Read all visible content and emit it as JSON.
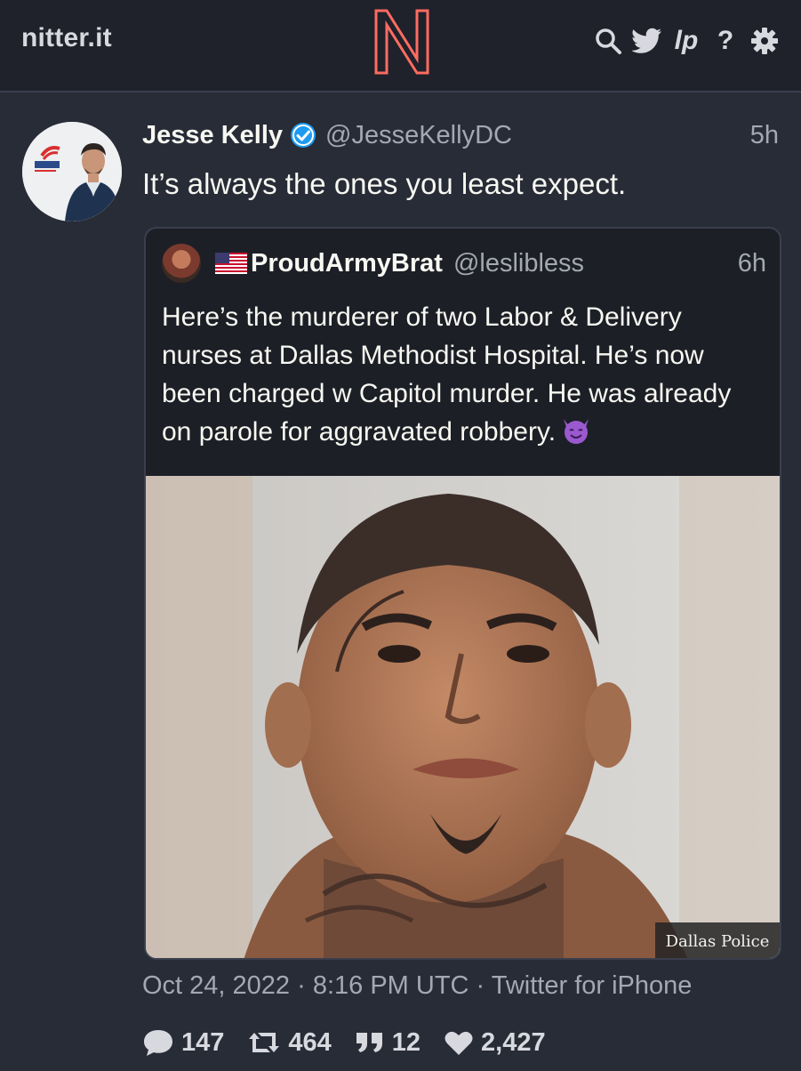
{
  "nav": {
    "site_name": "nitter.it",
    "logo_letter": "N",
    "icons": [
      "search-icon",
      "twitter-bird-icon",
      "lp-icon",
      "help-icon",
      "settings-icon"
    ],
    "lp_text": "lp",
    "help_text": "?"
  },
  "colors": {
    "background": "#282c37",
    "navbar": "#1f212b",
    "accent": "#ff6c60",
    "verified": "#1d9bf0",
    "muted": "#a4a8b2"
  },
  "tweet": {
    "fullname": "Jesse Kelly",
    "username": "@JesseKellyDC",
    "date": "5h",
    "text": "It’s always the ones you least expect.",
    "published": "Oct 24, 2022 · 8:16 PM UTC · Twitter for iPhone",
    "stats": {
      "replies": "147",
      "retweets": "464",
      "quotes": "12",
      "likes": "2,427"
    }
  },
  "quote": {
    "fullname": "ProudArmyBrat",
    "username": "@leslibless",
    "date": "6h",
    "text": "Here’s the murderer of two Labor & Delivery nurses at Dallas Methodist Hospital. He’s now been charged w Capitol murder. He was already on parole for aggravated robbery.",
    "media_caption": "Dallas Police"
  }
}
